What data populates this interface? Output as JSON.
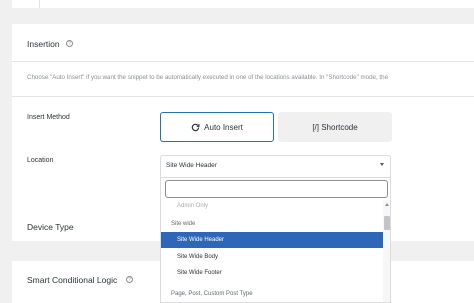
{
  "insertion": {
    "title": "Insertion",
    "description": "Choose \"Auto Insert\" if you want the snippet to be automatically executed in one of the locations available. In \"Shortcode\" mode, the"
  },
  "insert_method": {
    "label": "Insert Method",
    "auto_insert_label": "Auto Insert",
    "shortcode_label": "[/] Shortcode",
    "selected": "Auto Insert"
  },
  "location": {
    "label": "Location",
    "selected_value": "Site Wide Header",
    "search_value": "",
    "groups": [
      {
        "label": "",
        "items": [
          "Admin Only"
        ]
      },
      {
        "label": "Site wide",
        "items": [
          "Site Wide Header",
          "Site Wide Body",
          "Site Wide Footer"
        ]
      },
      {
        "label": "Page, Post, Custom Post Type",
        "items": []
      }
    ],
    "highlighted": "Site Wide Header"
  },
  "device_type": {
    "title": "Device Type"
  },
  "smart_logic": {
    "title": "Smart Conditional Logic"
  },
  "colors": {
    "accent": "#2271b1",
    "highlight": "#2f67b8"
  }
}
